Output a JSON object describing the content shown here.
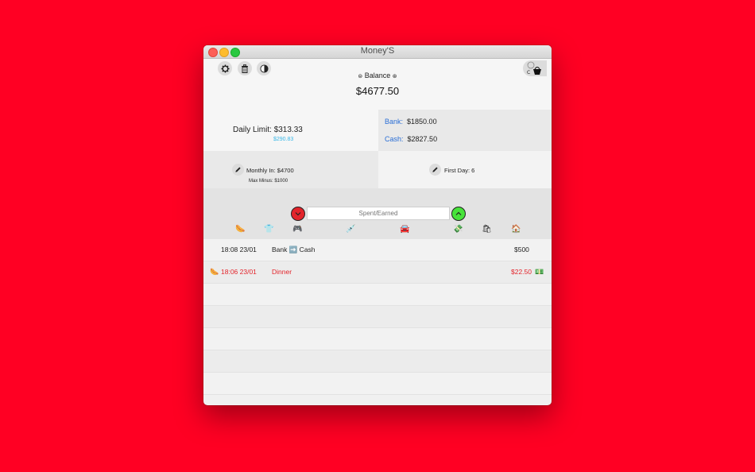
{
  "window": {
    "title": "Money'S"
  },
  "toolbar": {
    "settings_icon": "gear-icon",
    "trash_icon": "trash-icon",
    "theme_icon": "half-circle-icon"
  },
  "balance": {
    "label": "Balance",
    "value": "$4677.50"
  },
  "daily": {
    "label": "Daily Limit:",
    "value": "$313.33",
    "sub": "$290.83"
  },
  "accounts": {
    "bank_label": "Bank:",
    "bank_value": "$1850.00",
    "cash_label": "Cash:",
    "cash_value": "$2827.50"
  },
  "monthly": {
    "label": "Monthly In: $4700",
    "max_minus": "Max Minus: $1000"
  },
  "first_day": {
    "label": "First Day: 6"
  },
  "entry": {
    "placeholder": "Spent/Earned",
    "spent_color": "#e3242b",
    "earned_color": "#47e33a"
  },
  "categories": [
    "🌭",
    "👕",
    "🎮",
    "💉",
    "🚘",
    "💸",
    "🛍",
    "🏠"
  ],
  "transactions": [
    {
      "icon": "",
      "time": "18:08 23/01",
      "desc": "Bank ➡️ Cash",
      "amount": "$500",
      "type": "transfer",
      "suffix": ""
    },
    {
      "icon": "🌭",
      "time": "18:06 23/01",
      "desc": "Dinner",
      "amount": "$22.50",
      "type": "expense",
      "suffix": "💵"
    }
  ],
  "empty_rows": 5
}
